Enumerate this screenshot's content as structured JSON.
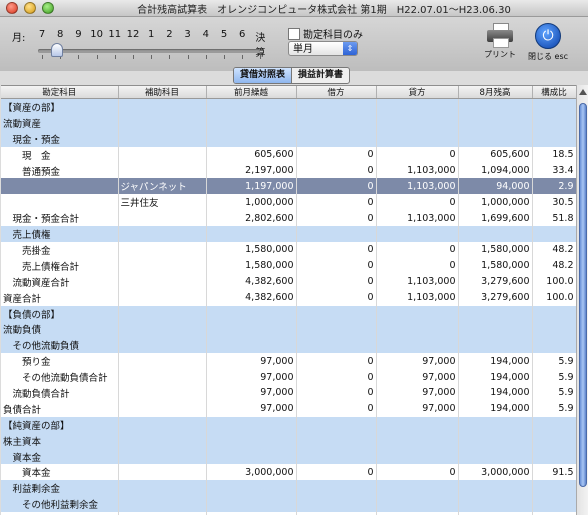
{
  "window": {
    "title": "合計残高試算表　オレンジコンピュータ株式会社 第1期　H22.07.01〜H23.06.30"
  },
  "toolbar": {
    "month_label": "月:",
    "months": [
      "7",
      "8",
      "9",
      "10",
      "11",
      "12",
      "1",
      "2",
      "3",
      "4",
      "5",
      "6",
      "決算"
    ],
    "checkbox_label": "勘定科目のみ",
    "select_value": "単月",
    "print_label": "プリント",
    "close_label": "閉じる esc"
  },
  "tabs": [
    {
      "label": "貸借対照表",
      "active": true
    },
    {
      "label": "損益計算書",
      "active": false
    }
  ],
  "table": {
    "headers": [
      "勘定科目",
      "補助科目",
      "前月繰越",
      "借方",
      "貸方",
      "8月残高",
      "構成比"
    ],
    "rows": [
      {
        "style": "blue",
        "cells": [
          "【資産の部】",
          "",
          "",
          "",
          "",
          "",
          ""
        ]
      },
      {
        "style": "blue",
        "cells": [
          "流動資産",
          "",
          "",
          "",
          "",
          "",
          ""
        ]
      },
      {
        "style": "blue",
        "cells": [
          "　現金・預金",
          "",
          "",
          "",
          "",
          "",
          ""
        ]
      },
      {
        "style": "white",
        "cells": [
          "　　現　金",
          "",
          "605,600",
          "0",
          "0",
          "605,600",
          "18.5"
        ]
      },
      {
        "style": "white",
        "cells": [
          "　　普通預金",
          "",
          "2,197,000",
          "0",
          "1,103,000",
          "1,094,000",
          "33.4"
        ]
      },
      {
        "style": "sel",
        "cells": [
          "",
          "ジャパンネット",
          "1,197,000",
          "0",
          "1,103,000",
          "94,000",
          "2.9"
        ]
      },
      {
        "style": "white",
        "cells": [
          "",
          "三井住友",
          "1,000,000",
          "0",
          "0",
          "1,000,000",
          "30.5"
        ]
      },
      {
        "style": "white",
        "cells": [
          "　現金・預金合計",
          "",
          "2,802,600",
          "0",
          "1,103,000",
          "1,699,600",
          "51.8"
        ]
      },
      {
        "style": "blue",
        "cells": [
          "　売上債権",
          "",
          "",
          "",
          "",
          "",
          ""
        ]
      },
      {
        "style": "white",
        "cells": [
          "　　売掛金",
          "",
          "1,580,000",
          "0",
          "0",
          "1,580,000",
          "48.2"
        ]
      },
      {
        "style": "white",
        "cells": [
          "　　売上債権合計",
          "",
          "1,580,000",
          "0",
          "0",
          "1,580,000",
          "48.2"
        ]
      },
      {
        "style": "white",
        "cells": [
          "　流動資産合計",
          "",
          "4,382,600",
          "0",
          "1,103,000",
          "3,279,600",
          "100.0"
        ]
      },
      {
        "style": "white",
        "cells": [
          "資産合計",
          "",
          "4,382,600",
          "0",
          "1,103,000",
          "3,279,600",
          "100.0"
        ]
      },
      {
        "style": "blue",
        "cells": [
          "【負債の部】",
          "",
          "",
          "",
          "",
          "",
          ""
        ]
      },
      {
        "style": "blue",
        "cells": [
          "流動負債",
          "",
          "",
          "",
          "",
          "",
          ""
        ]
      },
      {
        "style": "blue",
        "cells": [
          "　その他流動負債",
          "",
          "",
          "",
          "",
          "",
          ""
        ]
      },
      {
        "style": "white",
        "cells": [
          "　　預り金",
          "",
          "97,000",
          "0",
          "97,000",
          "194,000",
          "5.9"
        ]
      },
      {
        "style": "white",
        "cells": [
          "　　その他流動負債合計",
          "",
          "97,000",
          "0",
          "97,000",
          "194,000",
          "5.9"
        ]
      },
      {
        "style": "white",
        "cells": [
          "　流動負債合計",
          "",
          "97,000",
          "0",
          "97,000",
          "194,000",
          "5.9"
        ]
      },
      {
        "style": "white",
        "cells": [
          "負債合計",
          "",
          "97,000",
          "0",
          "97,000",
          "194,000",
          "5.9"
        ]
      },
      {
        "style": "blue",
        "cells": [
          "【純資産の部】",
          "",
          "",
          "",
          "",
          "",
          ""
        ]
      },
      {
        "style": "blue",
        "cells": [
          "株主資本",
          "",
          "",
          "",
          "",
          "",
          ""
        ]
      },
      {
        "style": "blue",
        "cells": [
          "　資本金",
          "",
          "",
          "",
          "",
          "",
          ""
        ]
      },
      {
        "style": "white",
        "cells": [
          "　　資本金",
          "",
          "3,000,000",
          "0",
          "0",
          "3,000,000",
          "91.5"
        ]
      },
      {
        "style": "blue",
        "cells": [
          "　利益剰余金",
          "",
          "",
          "",
          "",
          "",
          ""
        ]
      },
      {
        "style": "blue",
        "cells": [
          "　　その他利益剰余金",
          "",
          "",
          "",
          "",
          "",
          ""
        ]
      },
      {
        "style": "white",
        "cells": [
          "",
          "",
          "",
          "",
          "",
          "",
          ""
        ]
      }
    ]
  },
  "colors": {
    "row_blue": "#c6dcf4",
    "row_selected": "#7d8aa8"
  }
}
